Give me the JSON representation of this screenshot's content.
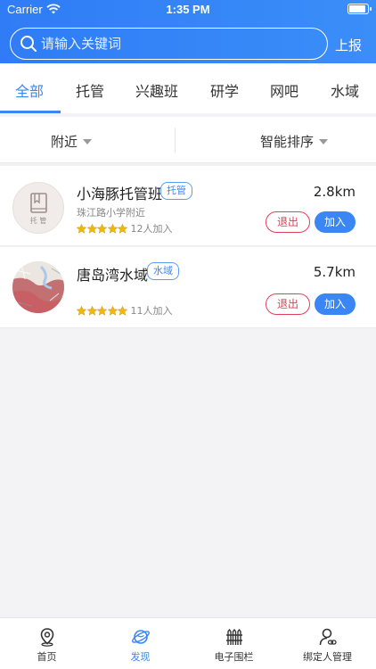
{
  "status": {
    "carrier": "Carrier",
    "time": "1:35 PM"
  },
  "search": {
    "placeholder": "请输入关键词",
    "report_label": "上报"
  },
  "tabs": [
    {
      "label": "全部",
      "active": true
    },
    {
      "label": "托管"
    },
    {
      "label": "兴趣班"
    },
    {
      "label": "研学"
    },
    {
      "label": "网吧"
    },
    {
      "label": "水域"
    }
  ],
  "filters": {
    "nearby": "附近",
    "sort": "智能排序"
  },
  "items": [
    {
      "name": "小海豚托管班",
      "tag": "托管",
      "address": "珠江路小学附近",
      "rating": 5,
      "joined": "12人加入",
      "distance": "2.8km",
      "quit_label": "退出",
      "join_label": "加入",
      "avatar_text": "托 管"
    },
    {
      "name": "唐岛湾水域",
      "tag": "水域",
      "address": "",
      "rating": 5,
      "joined": "11人加入",
      "distance": "5.7km",
      "quit_label": "退出",
      "join_label": "加入"
    }
  ],
  "tabbar": [
    {
      "label": "首页",
      "icon": "location-pin-icon"
    },
    {
      "label": "发现",
      "icon": "planet-icon",
      "active": true
    },
    {
      "label": "电子围栏",
      "icon": "fence-icon"
    },
    {
      "label": "绑定人管理",
      "icon": "person-link-icon"
    }
  ],
  "colors": {
    "primary": "#3a86f5",
    "danger": "#e0405a",
    "star": "#f5b800"
  }
}
